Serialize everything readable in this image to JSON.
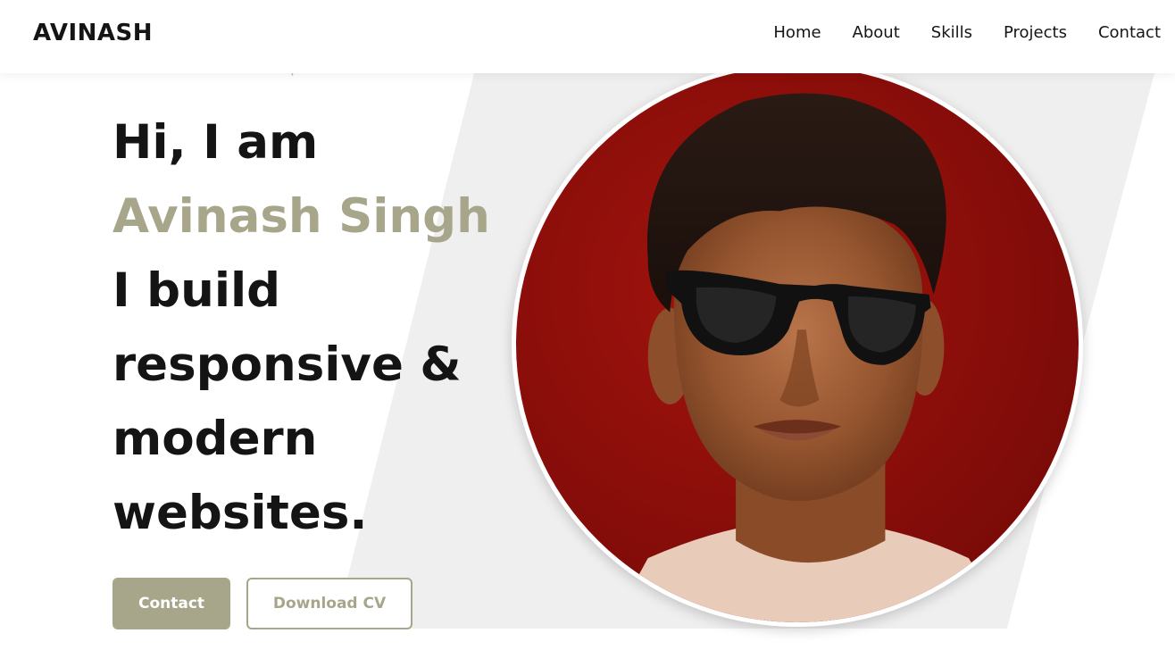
{
  "header": {
    "logo": "AVINASH",
    "nav": [
      "Home",
      "About",
      "Skills",
      "Projects",
      "Contact"
    ]
  },
  "hero": {
    "subtitle": "Full Stack Web Developer",
    "line1": "Hi, I am",
    "name": "Avinash Singh",
    "line3": "I build",
    "line4": "responsive &",
    "line5": "modern",
    "line6": "websites."
  },
  "buttons": {
    "contact": "Contact",
    "download": "Download CV"
  },
  "colors": {
    "accent": "#a8a68a",
    "text": "#141414",
    "panel": "#efefef",
    "photo_bg": "#8c0e0a"
  },
  "icons": {
    "profile": "profile-photo"
  }
}
